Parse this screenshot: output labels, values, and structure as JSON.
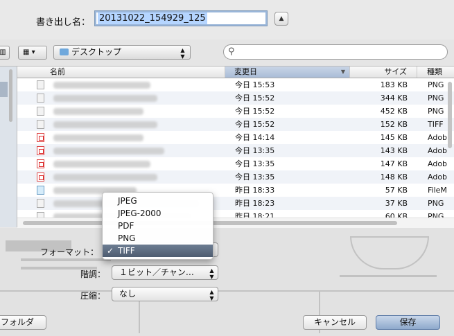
{
  "export": {
    "label": "書き出し名：",
    "filename": "20131022_154929_125",
    "expand_glyph": "▲"
  },
  "toolbar": {
    "columns_glyph": "▥",
    "arrange_glyph": "▦ ▾",
    "location": "デスクトップ",
    "select_arrows": "▲▼",
    "search_glyph": "⚲",
    "search_value": ""
  },
  "file_list": {
    "headers": {
      "name": "名前",
      "date": "変更日",
      "size": "サイズ",
      "kind": "種類"
    },
    "sort_glyph": "▼",
    "rows": [
      {
        "icon": "image-file-icon",
        "date": "今日 15:53",
        "size": "183 KB",
        "kind": "PNG"
      },
      {
        "icon": "image-file-icon",
        "date": "今日 15:52",
        "size": "344 KB",
        "kind": "PNG"
      },
      {
        "icon": "image-file-icon",
        "date": "今日 15:52",
        "size": "452 KB",
        "kind": "PNG"
      },
      {
        "icon": "image-file-icon",
        "date": "今日 15:52",
        "size": "152 KB",
        "kind": "TIFF"
      },
      {
        "icon": "pdf-file-icon",
        "date": "今日 14:14",
        "size": "145 KB",
        "kind": "Adob"
      },
      {
        "icon": "pdf-file-icon",
        "date": "今日 13:35",
        "size": "143 KB",
        "kind": "Adob"
      },
      {
        "icon": "pdf-file-icon",
        "date": "今日 13:35",
        "size": "147 KB",
        "kind": "Adob"
      },
      {
        "icon": "pdf-file-icon",
        "date": "今日 13:35",
        "size": "148 KB",
        "kind": "Adob"
      },
      {
        "icon": "document-file-icon",
        "date": "昨日 18:33",
        "size": "57 KB",
        "kind": "FileM"
      },
      {
        "icon": "image-file-icon",
        "date": "昨日 18:23",
        "size": "37 KB",
        "kind": "PNG"
      },
      {
        "icon": "image-file-icon",
        "date": "昨日 18:21",
        "size": "60 KB",
        "kind": "PNG"
      }
    ]
  },
  "options": {
    "format_label": "フォーマット：",
    "depth_label": "階調：",
    "depth_value": "１ビット／チャン…",
    "compression_label": "圧縮：",
    "compression_value": "なし",
    "select_arrows": "▲▼",
    "format_menu": {
      "items": [
        "JPEG",
        "JPEG-2000",
        "PDF",
        "PNG",
        "TIFF"
      ],
      "selected": "TIFF",
      "check_glyph": "✓"
    }
  },
  "buttons": {
    "new_folder": "フォルダ",
    "cancel": "キャンセル",
    "save": "保存"
  }
}
